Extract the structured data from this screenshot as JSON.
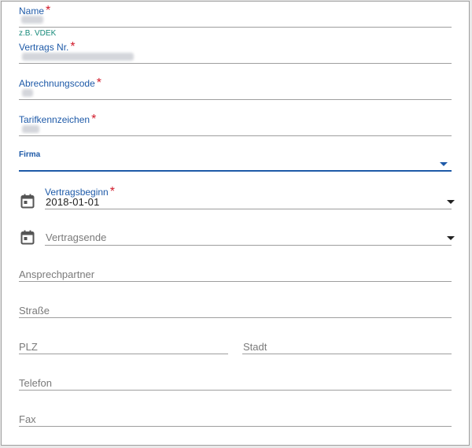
{
  "form": {
    "name": {
      "label": "Name",
      "required_mark": "*",
      "value": "",
      "hint": "z.B. VDEK"
    },
    "vertrags_nr": {
      "label": "Vertrags Nr.",
      "required_mark": "*",
      "value": ""
    },
    "abrechnungscode": {
      "label": "Abrechnungscode",
      "required_mark": "*",
      "value": ""
    },
    "tarifkennzeichen": {
      "label": "Tarifkennzeichen",
      "required_mark": "*",
      "value": ""
    },
    "firma": {
      "label": "Firma",
      "selected": ""
    },
    "vertragsbeginn": {
      "label": "Vertragsbeginn",
      "required_mark": "*",
      "value": "2018-01-01",
      "icon": "calendar-icon"
    },
    "vertragsende": {
      "placeholder": "Vertragsende",
      "icon": "calendar-icon"
    },
    "ansprechpartner": {
      "placeholder": "Ansprechpartner"
    },
    "strasse": {
      "placeholder": "Straße"
    },
    "plz": {
      "placeholder": "PLZ"
    },
    "stadt": {
      "placeholder": "Stadt"
    },
    "telefon": {
      "placeholder": "Telefon"
    },
    "fax": {
      "placeholder": "Fax"
    }
  },
  "colors": {
    "label": "#1e5aa8",
    "required": "#d11a2a",
    "hint": "#178a7a",
    "underline": "#9e9e9e",
    "active_underline": "#1e5aa8"
  }
}
